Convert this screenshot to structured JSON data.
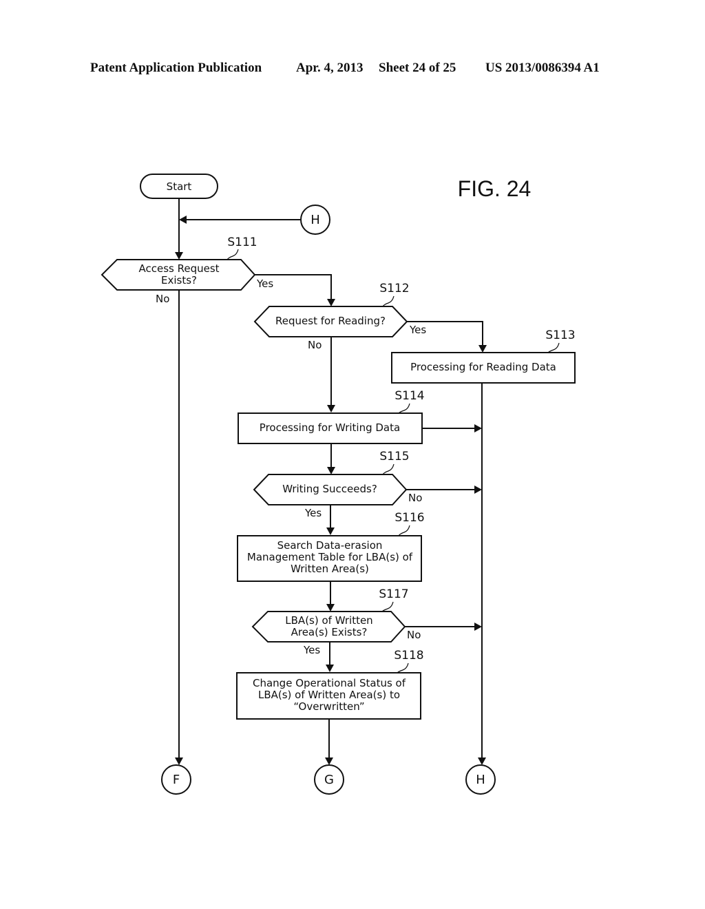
{
  "header": {
    "publication": "Patent Application Publication",
    "date": "Apr. 4, 2013",
    "sheet": "Sheet 24 of 25",
    "number": "US 2013/0086394 A1"
  },
  "figure": {
    "title": "FIG. 24"
  },
  "flowchart": {
    "start": "Start",
    "connectors": {
      "h_in": "H",
      "f_out": "F",
      "g_out": "G",
      "h_out": "H"
    },
    "steps": {
      "s111": {
        "id": "S111",
        "type": "decision",
        "lines": [
          "Access Request",
          "Exists?"
        ],
        "yes": "Yes",
        "no": "No"
      },
      "s112": {
        "id": "S112",
        "type": "decision",
        "lines": [
          "Request for Reading?"
        ],
        "yes": "Yes",
        "no": "No"
      },
      "s113": {
        "id": "S113",
        "type": "process",
        "lines": [
          "Processing for Reading Data"
        ]
      },
      "s114": {
        "id": "S114",
        "type": "process",
        "lines": [
          "Processing for Writing Data"
        ]
      },
      "s115": {
        "id": "S115",
        "type": "decision",
        "lines": [
          "Writing Succeeds?"
        ],
        "yes": "Yes",
        "no": "No"
      },
      "s116": {
        "id": "S116",
        "type": "process",
        "lines": [
          "Search Data-erasion",
          "Management Table for LBA(s) of",
          "Written Area(s)"
        ]
      },
      "s117": {
        "id": "S117",
        "type": "decision",
        "lines": [
          "LBA(s) of Written",
          "Area(s) Exists?"
        ],
        "yes": "Yes",
        "no": "No"
      },
      "s118": {
        "id": "S118",
        "type": "process",
        "lines": [
          "Change Operational Status of",
          "LBA(s) of Written Area(s) to",
          "“Overwritten”"
        ]
      }
    }
  }
}
